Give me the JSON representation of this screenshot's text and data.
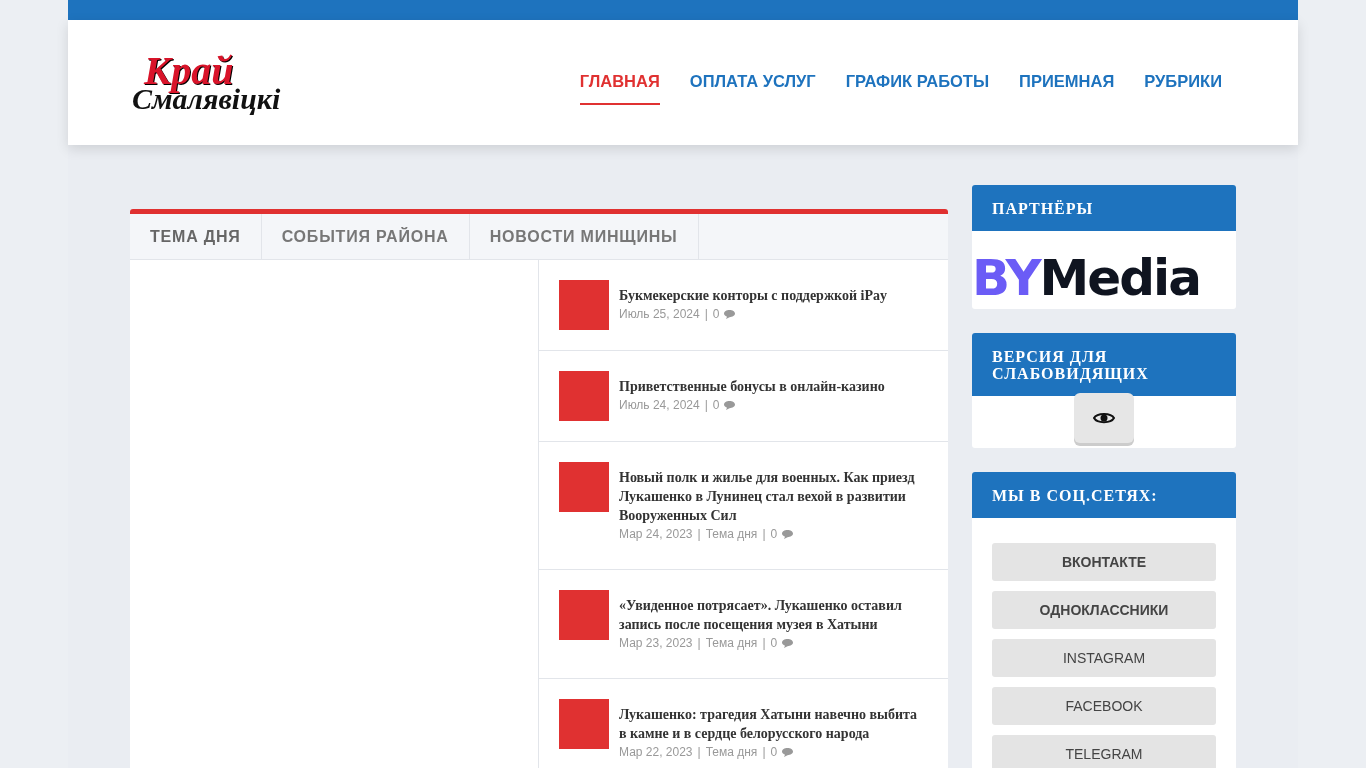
{
  "logo": {
    "top": "Край",
    "bottom": "Смалявіцкі"
  },
  "nav": [
    {
      "label": "ГЛАВНАЯ",
      "selected": true
    },
    {
      "label": "ОПЛАТА УСЛУГ",
      "selected": false
    },
    {
      "label": "ГРАФИК РАБОТЫ",
      "selected": false
    },
    {
      "label": "ПРИЕМНАЯ",
      "selected": false
    },
    {
      "label": "РУБРИКИ",
      "selected": false
    }
  ],
  "tabs": [
    {
      "label": "ТЕМА ДНЯ",
      "selected": true
    },
    {
      "label": "СОБЫТИЯ РАЙОНА",
      "selected": false
    },
    {
      "label": "НОВОСТИ МИНЩИНЫ",
      "selected": false
    }
  ],
  "meta_separator": "|",
  "posts": [
    {
      "title": "Букмекерские конторы с поддержкой iPay",
      "date": "Июль 25, 2024",
      "comments": "0"
    },
    {
      "title": "Приветственные бонусы в онлайн-казино",
      "date": "Июль 24, 2024",
      "comments": "0"
    },
    {
      "title": "Новый полк и жилье для военных. Как приезд Лукашенко в Лунинец стал вехой в развитии Вооруженных Сил",
      "date": "Мар 24, 2023",
      "category": "Тема дня",
      "comments": "0"
    },
    {
      "title": "«Увиденное потрясает». Лукашенко оставил запись после посещения музея в Хатыни",
      "date": "Мар 23, 2023",
      "category": "Тема дня",
      "comments": "0"
    },
    {
      "title": "Лукашенко: трагедия Хатыни навечно выбита в камне и в сердце белорусского народа",
      "date": "Мар 22, 2023",
      "category": "Тема дня",
      "comments": "0"
    }
  ],
  "sidebar": {
    "partners": {
      "title": "ПАРТНЁРЫ",
      "logo_a": "BY",
      "logo_b": "Media"
    },
    "accessibility": {
      "title": "ВЕРСИЯ ДЛЯ СЛАБОВИДЯЩИХ"
    },
    "social": {
      "title": "МЫ В СОЦ.СЕТЯХ:",
      "links": [
        "ВКОНТАКТЕ",
        "ОДНОКЛАССНИКИ",
        "INSTAGRAM",
        "FACEBOOK",
        "TELEGRAM"
      ]
    }
  }
}
